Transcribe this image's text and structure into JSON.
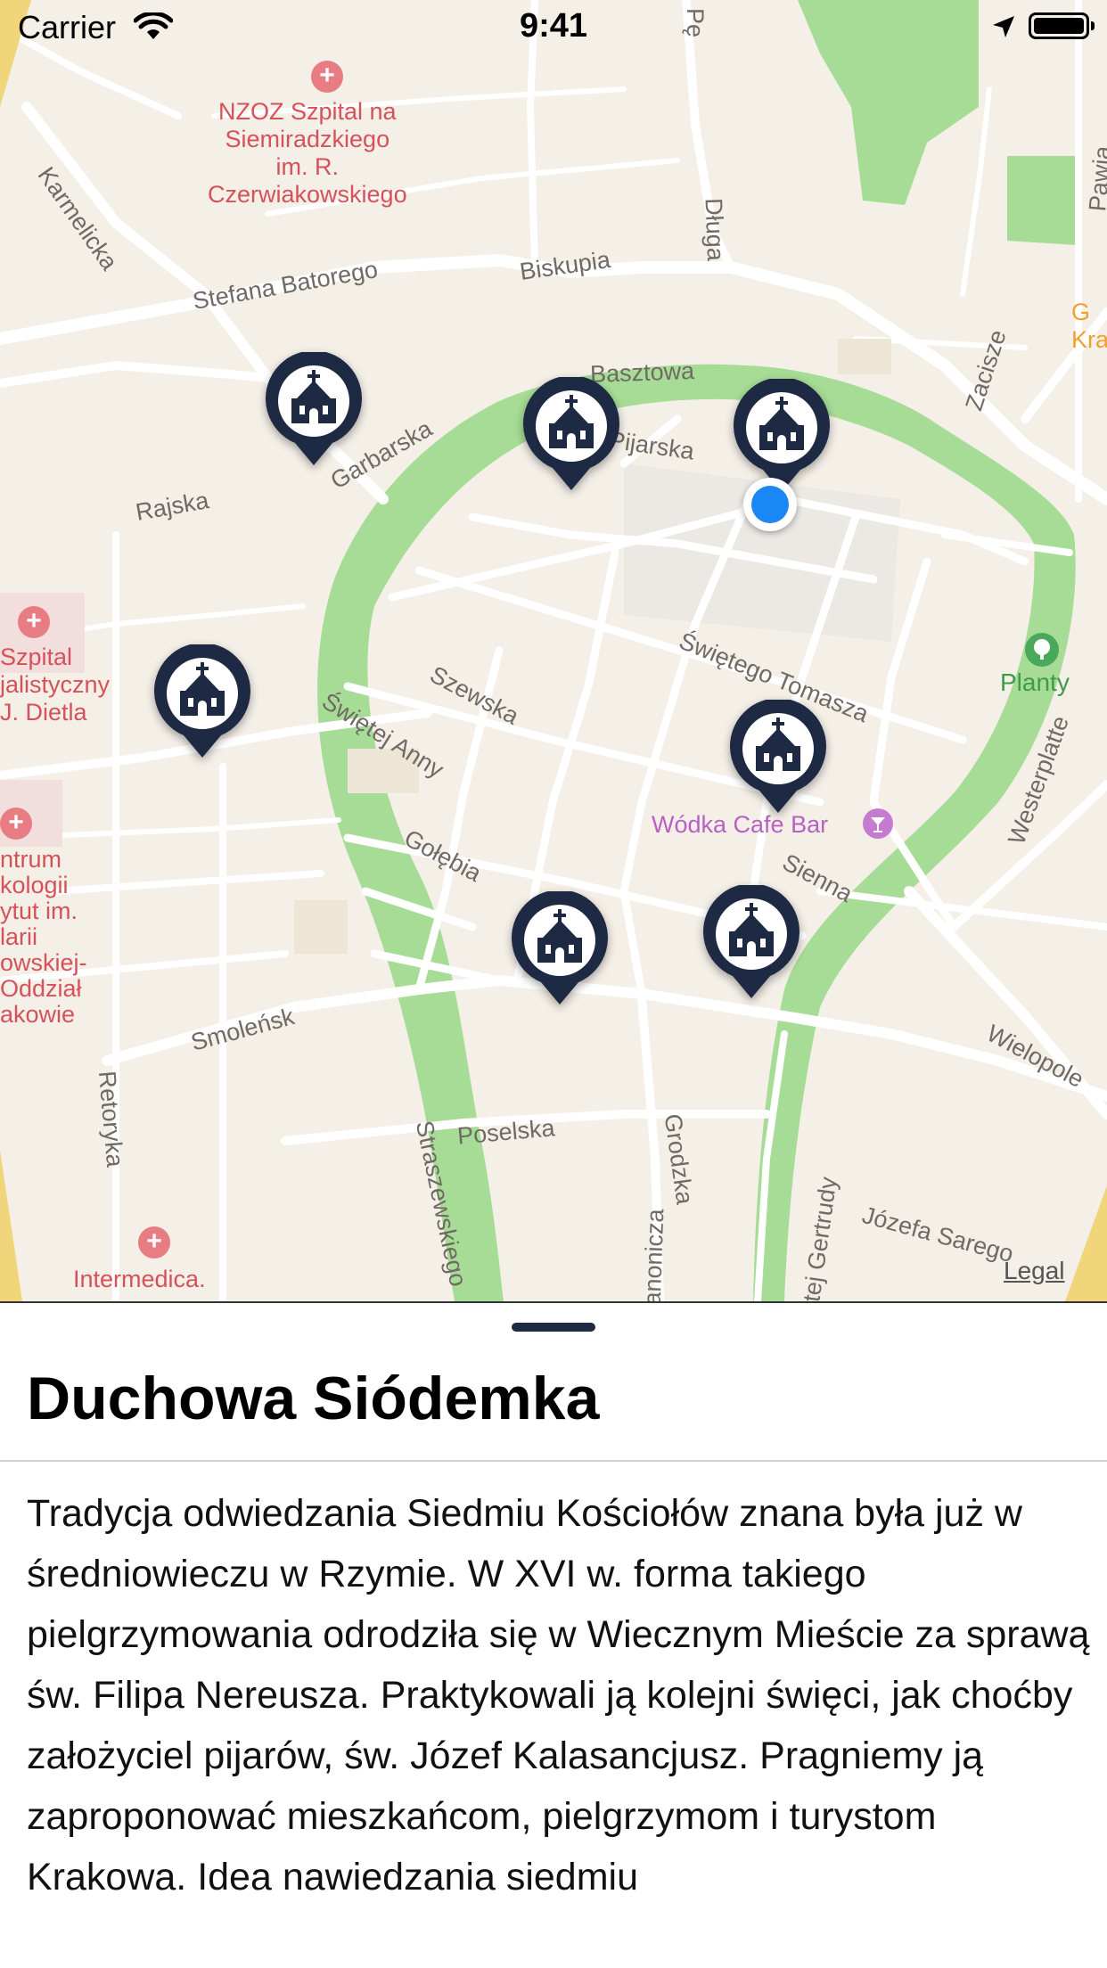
{
  "status_bar": {
    "carrier": "Carrier",
    "time": "9:41"
  },
  "map": {
    "streets": {
      "karmelicka": "Karmelicka",
      "stefana_batorego": "Stefana Batorego",
      "biskupia": "Biskupia",
      "dluga": "Długa",
      "pawia": "Pawia",
      "basztowa": "Basztowa",
      "zacisze": "Zacisze",
      "garbarska": "Garbarska",
      "pijarska": "Pijarska",
      "rajska": "Rajska",
      "swietego_tomasza": "Świętego Tomasza",
      "szewska": "Szewska",
      "swietej_anny": "Świętej Anny",
      "westerplatte": "Westerplatte",
      "golebia": "Gołębia",
      "sienna": "Sienna",
      "smolensk": "Smoleńsk",
      "wielopole": "Wielopole",
      "retoryka": "Retoryka",
      "poselska": "Poselska",
      "grodzka": "Grodzka",
      "straszewskiego": "Straszewskiego",
      "kanonicza": "anonicza",
      "swietej_gertrudy": "tej Gertrudy",
      "jozefa_sarego": "Józefa Sarego",
      "ped": "Pę"
    },
    "pois": {
      "hospital_nzoz": "NZOZ Szpital na\nSiemiradzkiego\nim. R.\nCzerwiakowskiego",
      "hospital_dietla": "Szpital\njalistyczny\nJ. Dietla",
      "oncology": "ntrum\nkologii\nytut im.\nlarii\nowskiej-\nOddział\nakowie",
      "intermedica": "Intermedica.",
      "planty": "Planty",
      "wodka_bar": "Wódka Cafe Bar",
      "edge_orange": "G\nKra"
    },
    "legal": "Legal",
    "church_pins": [
      "church-icon",
      "church-icon",
      "church-icon",
      "church-icon",
      "church-icon",
      "church-icon",
      "church-icon"
    ],
    "colors": {
      "map_bg": "#f4efe7",
      "park": "#a6dc95",
      "pin": "#1e2a44",
      "user_location": "#1a87f5"
    }
  },
  "sheet": {
    "title": "Duchowa Siódemka",
    "body": "Tradycja odwiedzania Siedmiu Kościołów znana była już w średniowieczu w Rzymie. W XVI w. forma takiego pielgrzymowania odrodziła się w Wiecznym Mieście za sprawą św. Filipa Nereusza. Praktykowali ją kolejni święci, jak choćby założyciel pijarów, św. Józef Kalasancjusz. Pragniemy ją zaproponować mieszkańcom, pielgrzymom i turystom Krakowa. Idea nawiedzania siedmiu"
  }
}
